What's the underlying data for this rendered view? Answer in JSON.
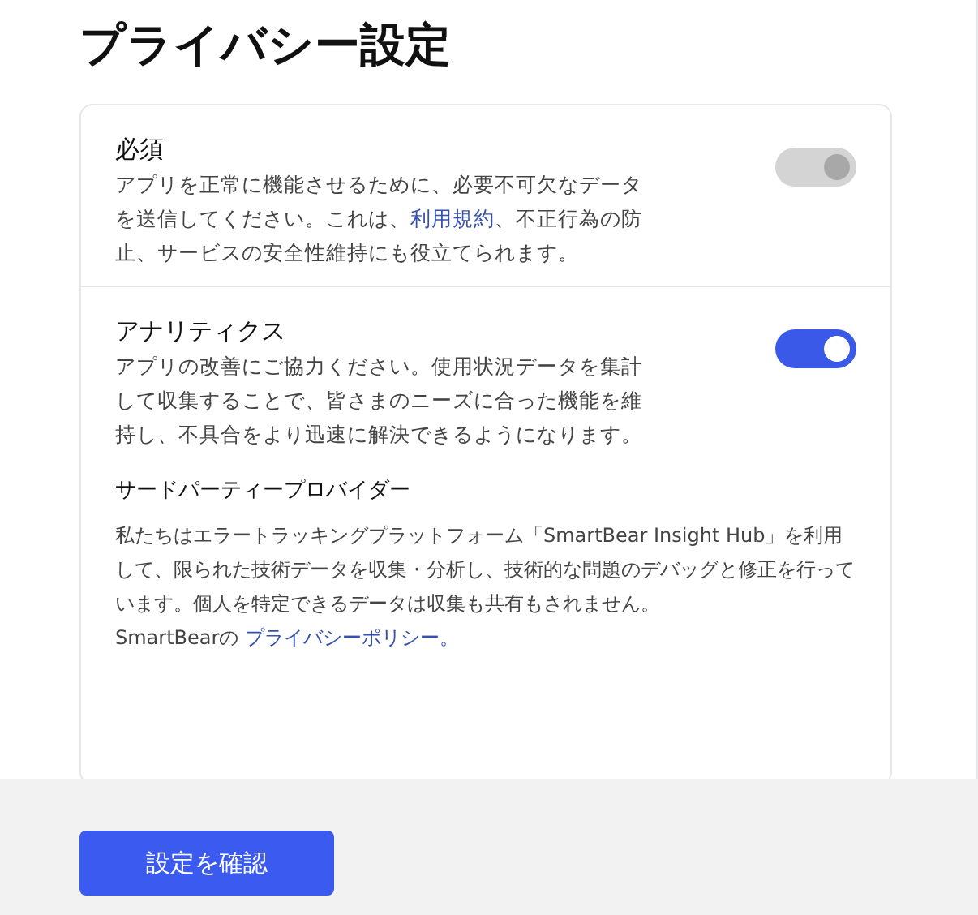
{
  "title": "プライバシー設定",
  "sections": [
    {
      "title": "必須",
      "before": "アプリを正常に機能させるために、必要不可欠なデータを送信してください。これは、",
      "link": "利用規約",
      "after": "、不正行為の防止、サービスの安全性維持にも役立てられます。",
      "on": true,
      "disabled": true
    },
    {
      "title": "アナリティクス",
      "before": "アプリの改善にご協力ください。使用状況データを集計して収集することで、皆さまのニーズに合った機能を維持し、不具合をより迅速に解決できるようになります。",
      "on": true,
      "disabled": false
    }
  ],
  "third_party": {
    "title": "サードパーティープロバイダー",
    "text": "私たちはエラートラッキングプラットフォーム「SmartBear Insight Hub」を利用して、限られた技術データを収集・分析し、技術的な問題のデバッグと修正を行っています。個人を特定できるデータは収集も共有もされません。",
    "prefix": "SmartBearの ",
    "link": "プライバシーポリシー。"
  },
  "confirm_button": "設定を確認"
}
